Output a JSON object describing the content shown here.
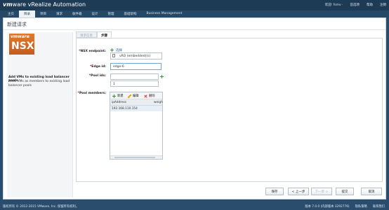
{
  "header": {
    "brand_prefix": "vm",
    "brand_rest": "ware vRealize Automation",
    "links": [
      "欢迎: fsmv ·",
      "首选项",
      "帮助",
      "注销"
    ]
  },
  "nav": {
    "tabs": [
      "主页",
      "目录",
      "项目",
      "请求",
      "收件箱",
      "设计",
      "管理",
      "基础架构",
      "Business Management"
    ],
    "active_index": 1
  },
  "page": {
    "title": "新建请求"
  },
  "left": {
    "logo_top": "vmware",
    "logo_main": "NSX",
    "item_name": "Add VMs to existing load balancer pools",
    "item_desc": "Adds VMs as members to existing load balancer pools"
  },
  "form_tabs": [
    "请求信息",
    "步骤"
  ],
  "fields": {
    "nsx_endpoint_label": "NSX endpoint:",
    "nsx_endpoint_link": "选择",
    "nsx_endpoint_value": "vRO (embedded)(s)",
    "edge_id_label": "Edge id:",
    "edge_id_value": "edge-6",
    "pool_ids_label": "Pool ids:",
    "pool_ids_value_1": "",
    "pool_ids_value_2": "1",
    "pool_members_label": "Pool members:"
  },
  "grid": {
    "toolbar": {
      "add": "新建",
      "edit": "编辑",
      "delete": "删除"
    },
    "columns": [
      "ipAddress",
      "weigh"
    ],
    "rows": [
      {
        "ipAddress": "192.168.110.154"
      }
    ]
  },
  "buttons": {
    "save": "保存",
    "prev": "< 上一步",
    "next": "下一步 >",
    "submit": "提交",
    "cancel": "取消"
  },
  "footer": {
    "copyright": "版权所有 © 2012-2015 VMware, Inc. 保留所有权利。",
    "version": "版本 7.0.0 (内部版本 3292776)",
    "privacy": "隐私策略",
    "contact": "联系我们"
  }
}
